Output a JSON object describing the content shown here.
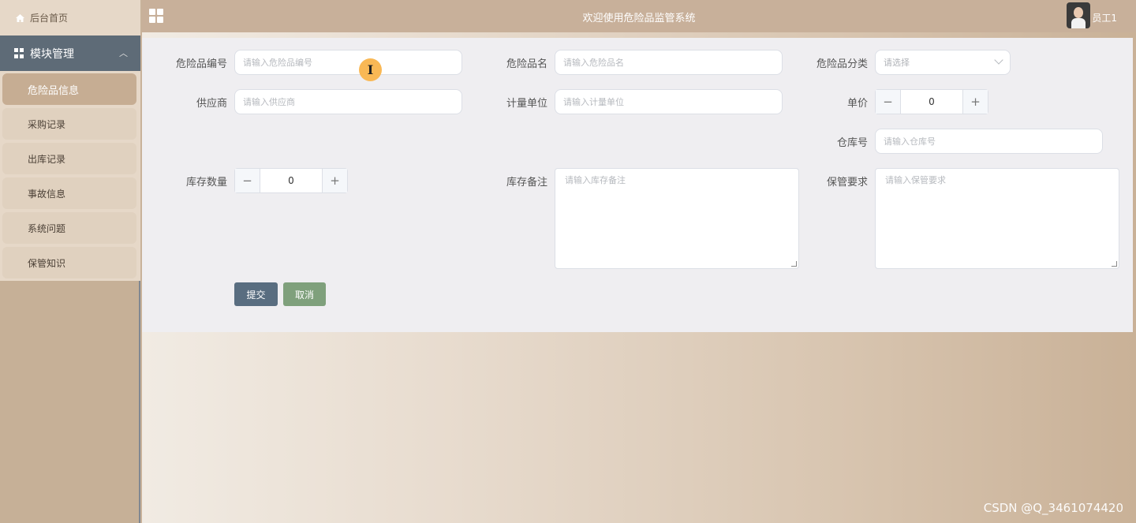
{
  "sidebar": {
    "home_label": "后台首页",
    "group_label": "模块管理",
    "items": [
      {
        "label": "危险品信息",
        "active": true
      },
      {
        "label": "采购记录"
      },
      {
        "label": "出库记录"
      },
      {
        "label": "事故信息"
      },
      {
        "label": "系统问题"
      },
      {
        "label": "保管知识"
      }
    ]
  },
  "header": {
    "title": "欢迎使用危险品监管系统",
    "user_name": "员工1"
  },
  "form": {
    "code": {
      "label": "危险品编号",
      "placeholder": "请输入危险品编号"
    },
    "name": {
      "label": "危险品名",
      "placeholder": "请输入危险品名"
    },
    "category": {
      "label": "危险品分类",
      "placeholder": "请选择"
    },
    "supplier": {
      "label": "供应商",
      "placeholder": "请输入供应商"
    },
    "unit": {
      "label": "计量单位",
      "placeholder": "请输入计量单位"
    },
    "price": {
      "label": "单价",
      "value": "0",
      "minus": "−",
      "plus": "+"
    },
    "warehouse": {
      "label": "仓库号",
      "placeholder": "请输入仓库号"
    },
    "stock": {
      "label": "库存数量",
      "value": "0",
      "minus": "−",
      "plus": "+"
    },
    "stock_note": {
      "label": "库存备注",
      "placeholder": "请输入库存备注"
    },
    "storage_req": {
      "label": "保管要求",
      "placeholder": "请输入保管要求"
    },
    "submit_label": "提交",
    "cancel_label": "取消"
  },
  "cursor_glyph": "I",
  "watermark": "CSDN @Q_3461074420",
  "colors": {
    "sidebar_bg": "#c6b097",
    "sidebar_group": "#5e6b77",
    "header_bg": "#c8b09a",
    "panel_bg": "#efeef1",
    "submit_btn": "#596d80",
    "cancel_btn": "#7fa07c",
    "cursor_marker": "#f9b855"
  },
  "icons": {
    "home": "home-icon",
    "group": "grid-icon",
    "group_toggle": "chevron-up-icon",
    "header_menu": "apps-icon",
    "select": "chevron-down-icon"
  }
}
